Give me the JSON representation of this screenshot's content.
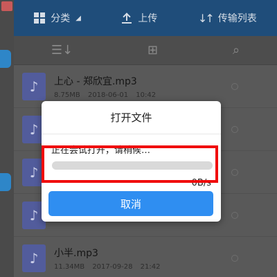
{
  "header": {
    "category_label": "分类",
    "upload_label": "上传",
    "transfer_label": "传输列表"
  },
  "toolbar": {
    "icons": [
      "sort-icon",
      "new-folder-icon",
      "search-icon"
    ]
  },
  "files": [
    {
      "name": "上心 - 郑欣宜.mp3",
      "size": "8.75MB",
      "date": "2018-06-01",
      "time": "10:42"
    },
    {
      "name": "",
      "size": "",
      "date": "",
      "time": ""
    },
    {
      "name": "",
      "size": "",
      "date": "",
      "time": ""
    },
    {
      "name": "",
      "size": "",
      "date": "",
      "time": ""
    },
    {
      "name": "小半.mp3",
      "size": "11.34MB",
      "date": "2017-09-28",
      "time": "21:42"
    }
  ],
  "dialog": {
    "title": "打开文件",
    "message": "正在尝试打开，请稍候…",
    "progress": 0,
    "speed": "0B/s",
    "cancel_label": "取消"
  },
  "colors": {
    "accent": "#2f8ef1",
    "highlight": "#f00a0a",
    "header": "#1f4d7a"
  }
}
